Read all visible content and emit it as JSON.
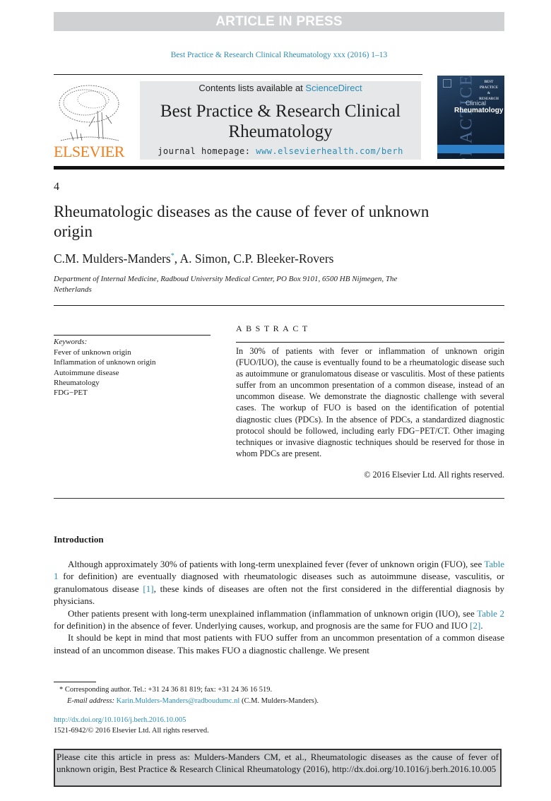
{
  "banner": {
    "label": "ARTICLE IN PRESS"
  },
  "journal_reference": "Best Practice & Research Clinical Rheumatology xxx (2016) 1–13",
  "masthead": {
    "contents_prefix": "Contents lists available at ",
    "contents_link": "ScienceDirect",
    "journal_title": "Best Practice & Research Clinical Rheumatology",
    "homepage_prefix": "journal homepage: ",
    "homepage_url": "www.elsevierhealth.com/berh",
    "publisher_logo_text": "ELSEVIER",
    "cover": {
      "series": "BEST PRACTICE & RESEARCH",
      "side_text": "PRACTICE",
      "line1": "Clinical",
      "line2": "Rheumatology"
    }
  },
  "article": {
    "number": "4",
    "title": "Rheumatologic diseases as the cause of fever of unknown origin",
    "authors": [
      {
        "name": "C.M. Mulders-Manders",
        "mark": "*"
      },
      {
        "name": "A. Simon"
      },
      {
        "name": "C.P. Bleeker-Rovers"
      }
    ],
    "affiliation": "Department of Internal Medicine, Radboud University Medical Center, PO Box 9101, 6500 HB Nijmegen, The Netherlands"
  },
  "keywords": {
    "heading": "Keywords:",
    "items": [
      "Fever of unknown origin",
      "Inflammation of unknown origin",
      "Autoimmune disease",
      "Rheumatology",
      "FDG−PET"
    ]
  },
  "abstract": {
    "heading": "ABSTRACT",
    "text": "In 30% of patients with fever or inflammation of unknown origin (FUO/IUO), the cause is eventually found to be a rheumatologic disease such as autoimmune or granulomatous disease or vasculitis. Most of these patients suffer from an uncommon presentation of a common disease, instead of an uncommon disease. We demonstrate the diagnostic challenge with several cases. The workup of FUO is based on the identification of potential diagnostic clues (PDCs). In the absence of PDCs, a standardized diagnostic protocol should be followed, including early FDG−PET/CT. Other imaging techniques or invasive diagnostic techniques should be reserved for those in whom PDCs are present.",
    "copyright": "© 2016 Elsevier Ltd. All rights reserved."
  },
  "introduction": {
    "heading": "Introduction",
    "p1": {
      "a": "Although approximately 30% of patients with long-term unexplained fever (fever of unknown origin (FUO), see ",
      "link1": "Table 1",
      "b": " for definition) are eventually diagnosed with rheumatologic diseases such as autoimmune disease, vasculitis, or granulomatous disease ",
      "ref1": "[1]",
      "c": ", these kinds of diseases are often not the first considered in the differential diagnosis by physicians."
    },
    "p2": {
      "a": "Other patients present with long-term unexplained inflammation (inflammation of unknown origin (IUO), see ",
      "link1": "Table 2",
      "b": " for definition) in the absence of fever. Underlying causes, workup, and prognosis are the same for FUO and IUO ",
      "ref1": "[2]",
      "c": "."
    },
    "p3": "It should be kept in mind that most patients with FUO suffer from an uncommon presentation of a common disease instead of an uncommon disease. This makes FUO a diagnostic challenge. We present"
  },
  "footnote": {
    "corresponding": "* Corresponding author. Tel.: +31 24 36 81 819; fax: +31 24 36 16 519.",
    "email_label": "E-mail address:",
    "email": "Karin.Mulders-Manders@radboudumc.nl",
    "email_suffix": " (C.M. Mulders-Manders)."
  },
  "doi": {
    "url": "http://dx.doi.org/10.1016/j.berh.2016.10.005",
    "issn_line": "1521-6942/© 2016 Elsevier Ltd. All rights reserved."
  },
  "citation_box": "Please cite this article in press as: Mulders-Manders CM, et al., Rheumatologic diseases as the cause of fever of unknown origin, Best Practice & Research Clinical Rheumatology (2016), http://dx.doi.org/10.1016/j.berh.2016.10.005",
  "colors": {
    "link": "#2a8cb5",
    "elsevier_orange": "#f07f1d",
    "banner_gray": "#d0d1d3",
    "masthead_gray": "#e6e7e8"
  }
}
